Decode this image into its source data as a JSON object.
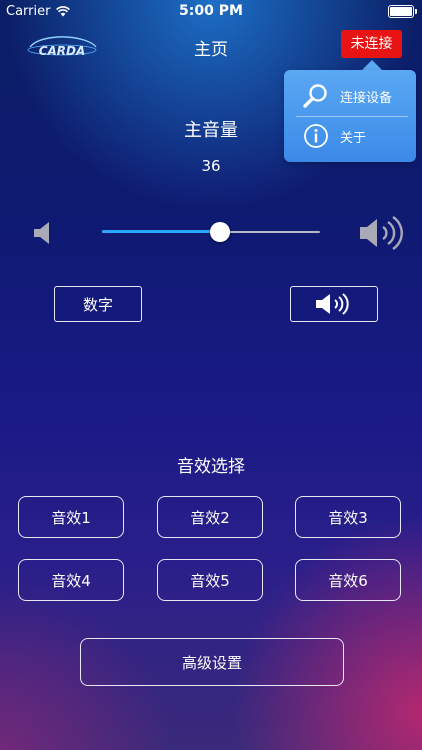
{
  "status_bar": {
    "carrier": "Carrier",
    "time": "5:00 PM"
  },
  "nav": {
    "logo_text": "CARDA",
    "title": "主页",
    "connect_status": "未连接"
  },
  "popover": {
    "items": [
      {
        "label": "连接设备",
        "icon": "search-icon"
      },
      {
        "label": "关于",
        "icon": "info-icon"
      }
    ]
  },
  "volume": {
    "title": "主音量",
    "value": "36",
    "level": 0.54
  },
  "mode_buttons": {
    "digital_label": "数字",
    "sound_icon": "speaker-sound-icon"
  },
  "effects": {
    "title": "音效选择",
    "buttons": [
      "音效1",
      "音效2",
      "音效3",
      "音效4",
      "音效5",
      "音效6"
    ]
  },
  "advanced": {
    "label": "高级设置"
  },
  "colors": {
    "accent": "#2aa8ff",
    "connect_red": "#e81414",
    "popover_blue": "#4a9cf0"
  }
}
